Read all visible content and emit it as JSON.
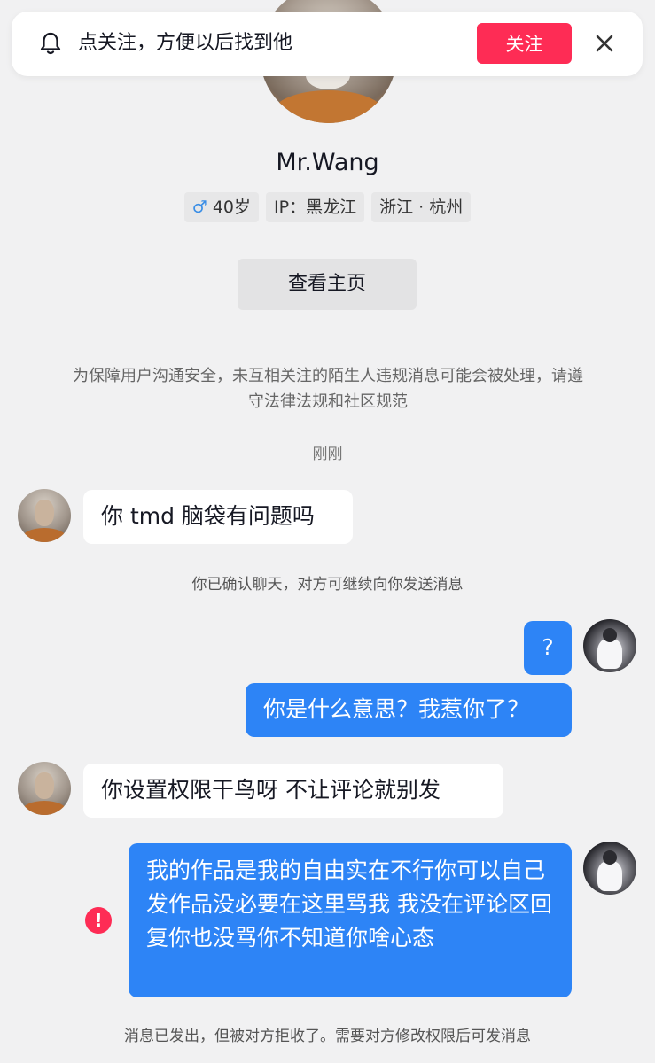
{
  "banner": {
    "icon": "bell-icon",
    "text": "点关注，方便以后找到他",
    "follow_label": "关注",
    "close_icon": "close-icon"
  },
  "profile": {
    "name": "Mr.Wang",
    "gender_symbol": "♂",
    "age": "40岁",
    "ip": "IP：黑龙江",
    "location": "浙江 · 杭州",
    "view_home_label": "查看主页"
  },
  "notice": "为保障用户沟通安全，未互相关注的陌生人违规消息可能会被处理，请遵守法律法规和社区规范",
  "time": "刚刚",
  "messages": [
    {
      "side": "left",
      "text": "你 tmd 脑袋有问题吗"
    },
    {
      "side": "right",
      "text": "?"
    },
    {
      "side": "right",
      "text": "你是什么意思？我惹你了？"
    },
    {
      "side": "left",
      "text": "你设置权限干鸟呀 不让评论就别发"
    },
    {
      "side": "right",
      "text": "我的作品是我的自由实在不行你可以自己发作品没必要在这里骂我 我没在评论区回复你也没骂你不知道你啥心态",
      "status": "failed"
    }
  ],
  "system": {
    "confirmed": "你已确认聊天，对方可继续向你发送消息",
    "rejected": "消息已发出，但被对方拒收了。需要对方修改权限后可发消息"
  },
  "colors": {
    "accent_red": "#fe2c55",
    "bubble_blue": "#2d84f6",
    "background": "#f1f1f2"
  },
  "error_mark": "!"
}
